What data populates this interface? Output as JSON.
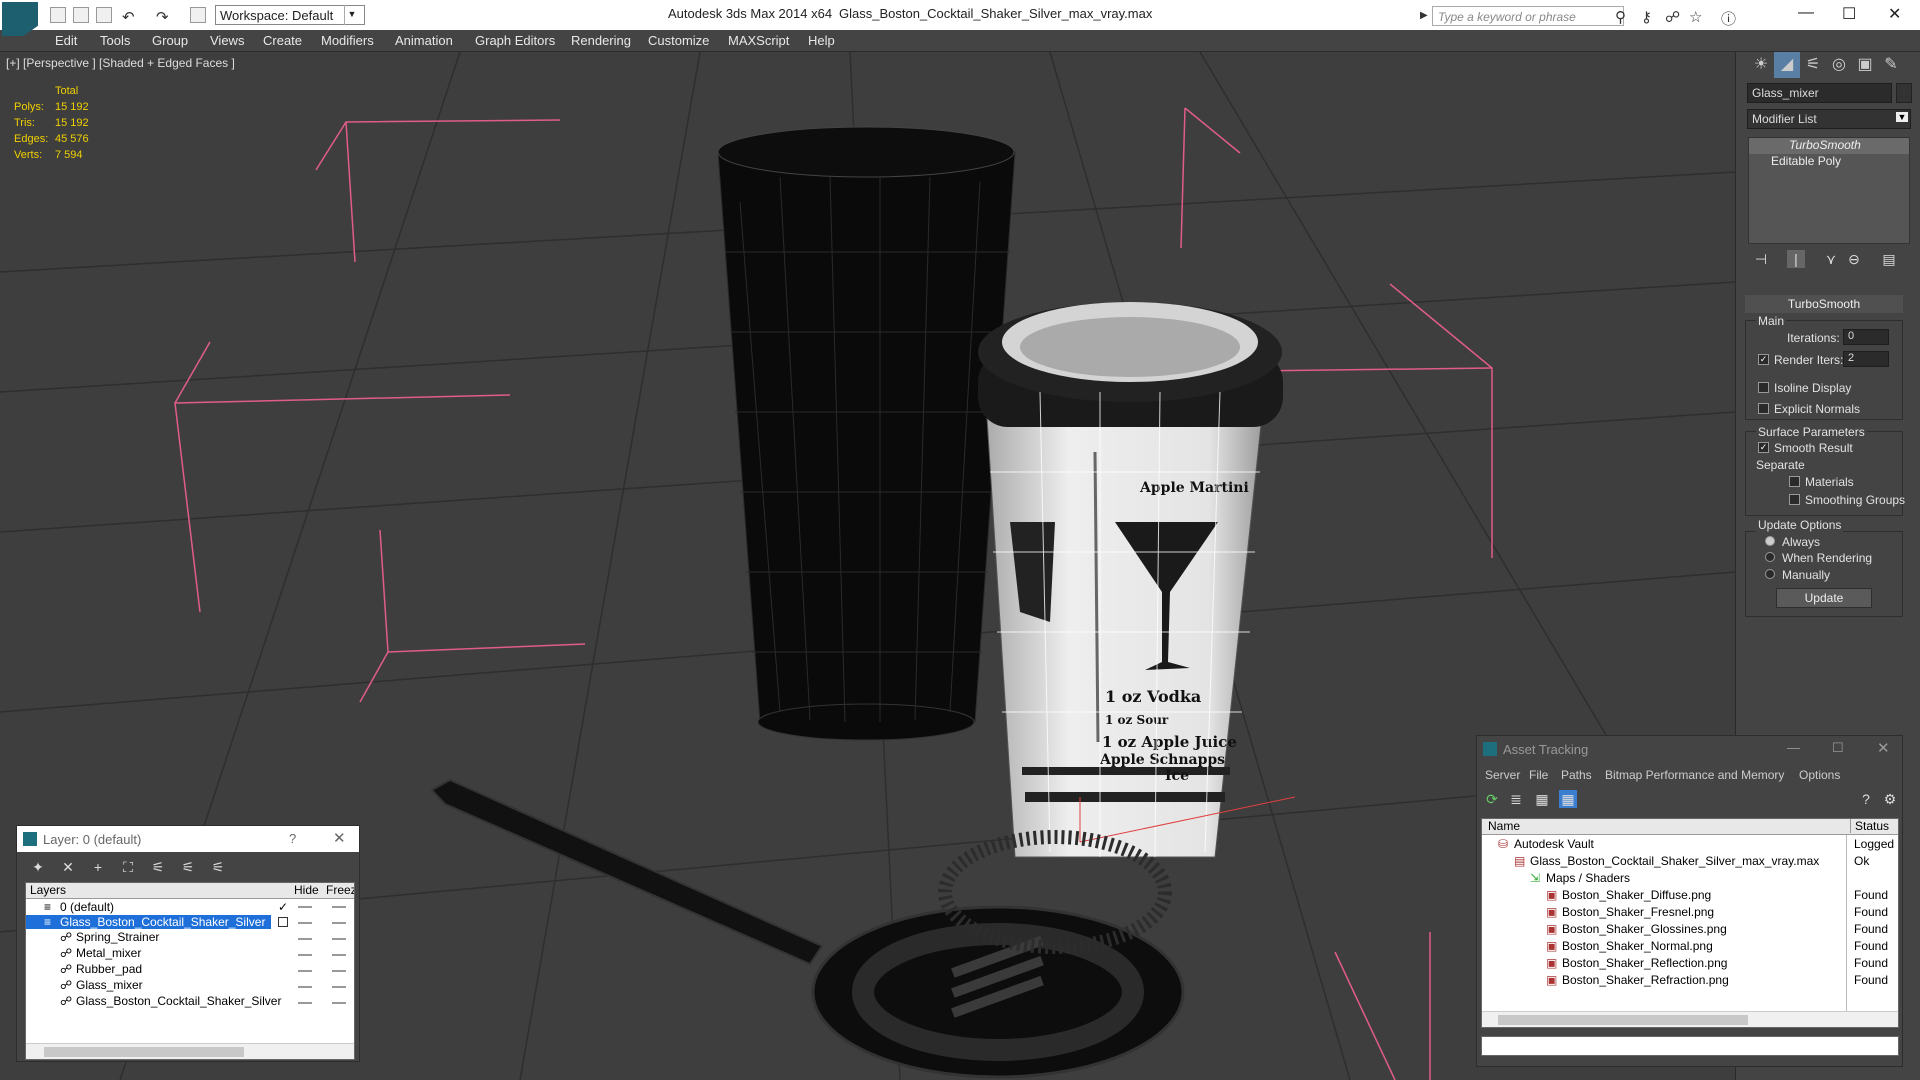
{
  "titlebar": {
    "app": "Autodesk 3ds Max  2014 x64",
    "file": "Glass_Boston_Cocktail_Shaker_Silver_max_vray.max",
    "workspace": "Workspace: Default",
    "search_placeholder": "Type a keyword or phrase"
  },
  "menu": [
    "Edit",
    "Tools",
    "Group",
    "Views",
    "Create",
    "Modifiers",
    "Animation",
    "Graph Editors",
    "Rendering",
    "Customize",
    "MAXScript",
    "Help"
  ],
  "viewport": {
    "label": "[+] [Perspective ] [Shaded + Edged Faces ]",
    "stats": {
      "header": "Total",
      "polys_label": "Polys:",
      "polys": "15 192",
      "tris_label": "Tris:",
      "tris": "15 192",
      "edges_label": "Edges:",
      "edges": "45 576",
      "verts_label": "Verts:",
      "verts": "7 594"
    },
    "label_text": {
      "l1": "Apple Martini",
      "l2": "1 oz Vodka",
      "l3": "1 oz Sour",
      "l4": "1 oz Apple Juice",
      "l5": "Apple Schnapps",
      "l6": "Ice"
    }
  },
  "command_panel": {
    "object_name": "Glass_mixer",
    "modifier_list": "Modifier List",
    "stack": [
      "TurboSmooth",
      "Editable Poly"
    ],
    "rollout_title": "TurboSmooth",
    "main": "Main",
    "iterations_label": "Iterations:",
    "iterations": "0",
    "render_iters_label": "Render Iters:",
    "render_iters": "2",
    "isoline": "Isoline Display",
    "explicit_normals": "Explicit Normals",
    "surface_params": "Surface Parameters",
    "smooth_result": "Smooth Result",
    "separate": "Separate",
    "materials": "Materials",
    "smoothing_groups": "Smoothing Groups",
    "update_options": "Update Options",
    "always": "Always",
    "when_rendering": "When Rendering",
    "manually": "Manually",
    "update_btn": "Update"
  },
  "layer_window": {
    "title": "Layer: 0 (default)",
    "help": "?",
    "col_layers": "Layers",
    "col_hide": "Hide",
    "col_freeze": "Freeze",
    "rows": [
      "0 (default)",
      "Glass_Boston_Cocktail_Shaker_Silver",
      "Spring_Strainer",
      "Metal_mixer",
      "Rubber_pad",
      "Glass_mixer",
      "Glass_Boston_Cocktail_Shaker_Silver"
    ]
  },
  "asset_window": {
    "title": "Asset Tracking",
    "menus": [
      "Server",
      "File",
      "Paths",
      "Bitmap Performance and Memory",
      "Options"
    ],
    "col_name": "Name",
    "col_status": "Status",
    "rows": [
      {
        "name": "Autodesk Vault",
        "status": "Logged O"
      },
      {
        "name": "Glass_Boston_Cocktail_Shaker_Silver_max_vray.max",
        "status": "Ok"
      },
      {
        "name": "Maps / Shaders",
        "status": ""
      },
      {
        "name": "Boston_Shaker_Diffuse.png",
        "status": "Found"
      },
      {
        "name": "Boston_Shaker_Fresnel.png",
        "status": "Found"
      },
      {
        "name": "Boston_Shaker_Glossines.png",
        "status": "Found"
      },
      {
        "name": "Boston_Shaker_Normal.png",
        "status": "Found"
      },
      {
        "name": "Boston_Shaker_Reflection.png",
        "status": "Found"
      },
      {
        "name": "Boston_Shaker_Refraction.png",
        "status": "Found"
      }
    ]
  }
}
